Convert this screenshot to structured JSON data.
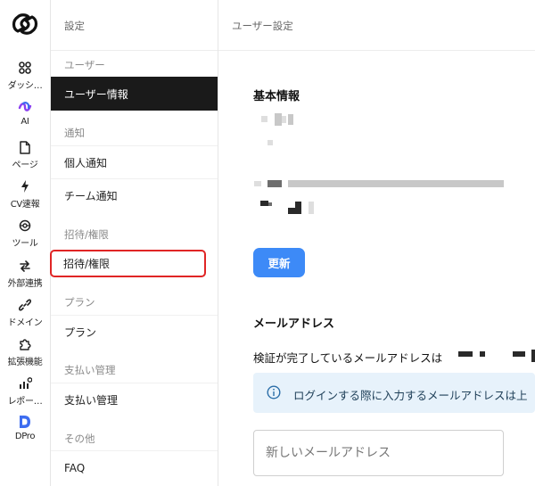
{
  "rail": {
    "items": [
      {
        "icon": "dashboard-grid-icon",
        "label": "ダッシ…"
      },
      {
        "icon": "ai-icon",
        "label": "AI"
      },
      {
        "icon": "page-icon",
        "label": "ページ"
      },
      {
        "icon": "bolt-icon",
        "label": "CV速報"
      },
      {
        "icon": "tool-icon",
        "label": "ツール"
      },
      {
        "icon": "sync-arrows-icon",
        "label": "外部連携"
      },
      {
        "icon": "link-icon",
        "label": "ドメイン"
      },
      {
        "icon": "puzzle-icon",
        "label": "拡張機能"
      },
      {
        "icon": "report-chart-icon",
        "label": "レポー…"
      },
      {
        "icon": "dpro-logo-icon",
        "label": "DPro"
      }
    ],
    "brand_color": "#3d6df0"
  },
  "sidebar": {
    "title": "設定",
    "sections": [
      {
        "label": "ユーザー",
        "items": [
          {
            "label": "ユーザー情報",
            "active": true
          }
        ]
      },
      {
        "label": "通知",
        "items": [
          {
            "label": "個人通知"
          },
          {
            "label": "チーム通知"
          }
        ]
      },
      {
        "label": "招待/権限",
        "items": [
          {
            "label": "招待/権限",
            "highlighted": true
          }
        ]
      },
      {
        "label": "プラン",
        "items": [
          {
            "label": "プラン"
          }
        ]
      },
      {
        "label": "支払い管理",
        "items": [
          {
            "label": "支払い管理"
          }
        ]
      },
      {
        "label": "その他",
        "items": [
          {
            "label": "FAQ"
          }
        ]
      }
    ]
  },
  "main": {
    "breadcrumb": "ユーザー設定",
    "basic_info": {
      "heading": "基本情報"
    },
    "update_button": "更新",
    "email": {
      "heading": "メールアドレス",
      "verified_text": "検証が完了しているメールアドレスは",
      "info_text": "ログインする際に入力するメールアドレスは上",
      "new_email_placeholder": "新しいメールアドレス"
    }
  },
  "colors": {
    "primary_button": "#3d8af7",
    "active_nav": "#1a1a1a",
    "highlight_outline": "#e02525",
    "info_bg": "#e7f2fb"
  }
}
